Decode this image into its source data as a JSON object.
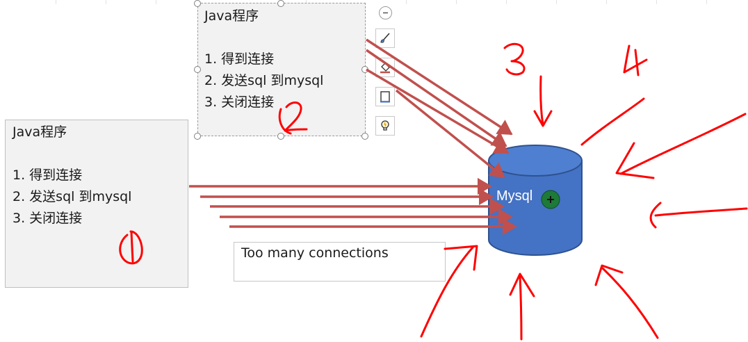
{
  "box_top": {
    "title": "Java程序",
    "items": [
      "1. 得到连接",
      "2. 发送sql 到mysql",
      "3. 关闭连接"
    ]
  },
  "box_left": {
    "title": "Java程序",
    "items": [
      "1. 得到连接",
      "2. 发送sql 到mysql",
      "3. 关闭连接"
    ]
  },
  "error_box": {
    "text": "Too many connections"
  },
  "database": {
    "label": "Mysql",
    "fill": "#4472c4"
  },
  "colors": {
    "arrow": "#c0504d",
    "handwriting": "#ff0000"
  },
  "toolbar": {
    "icons": [
      "collapse-icon",
      "brush-icon",
      "fill-icon",
      "frame-icon",
      "lightbulb-icon"
    ]
  }
}
